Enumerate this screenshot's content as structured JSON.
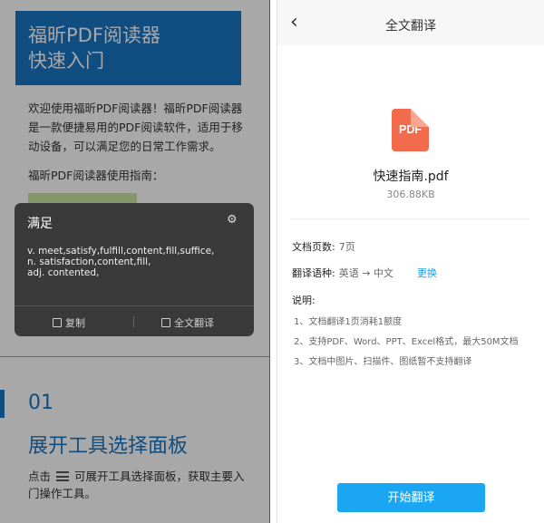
{
  "left": {
    "banner_line1": "福昕PDF阅读器",
    "banner_line2": "快速入门",
    "intro": "欢迎使用福昕PDF阅读器！福昕PDF阅读器是一款便捷易用的PDF阅读软件，适用于移动设备，可以满足您的日常工作需求。",
    "guide": "福昕PDF阅读器使用指南：",
    "section_number": "01",
    "section_title": "展开工具选择面板",
    "section_body_before": "点击",
    "section_body_after": "可展开工具选择面板，获取主要入门操作工具。"
  },
  "popup": {
    "word": "满足",
    "definitions": [
      "v. meet,satisfy,fulfill,content,fill,suffice,",
      "n. satisfaction,content,fill,",
      "adj. contented,"
    ],
    "copy_label": "复制",
    "full_translate_label": "全文翻译"
  },
  "right": {
    "nav_title": "全文翻译",
    "back_glyph": "‹",
    "pdf_badge": "PDF",
    "file_name": "快速指南.pdf",
    "file_size": "306.88KB",
    "pages_label": "文档页数:",
    "pages_value": "7页",
    "lang_label": "翻译语种:",
    "lang_value": "英语 → 中文",
    "change_label": "更换",
    "notes_title": "说明:",
    "notes": [
      "1、文档翻译1页消耗1额度",
      "2、支持PDF、Word、PPT、Excel格式，最大50M文档",
      "3、文档中图片、扫描件、图纸暂不支持翻译"
    ],
    "start_button": "开始翻译"
  },
  "colors": {
    "brand_blue": "#1976c2",
    "action_blue": "#1aa6f0",
    "pdf_red": "#f36b4d",
    "highlight_green": "#c8e6a0",
    "popup_bg": "#3a3a3a"
  }
}
